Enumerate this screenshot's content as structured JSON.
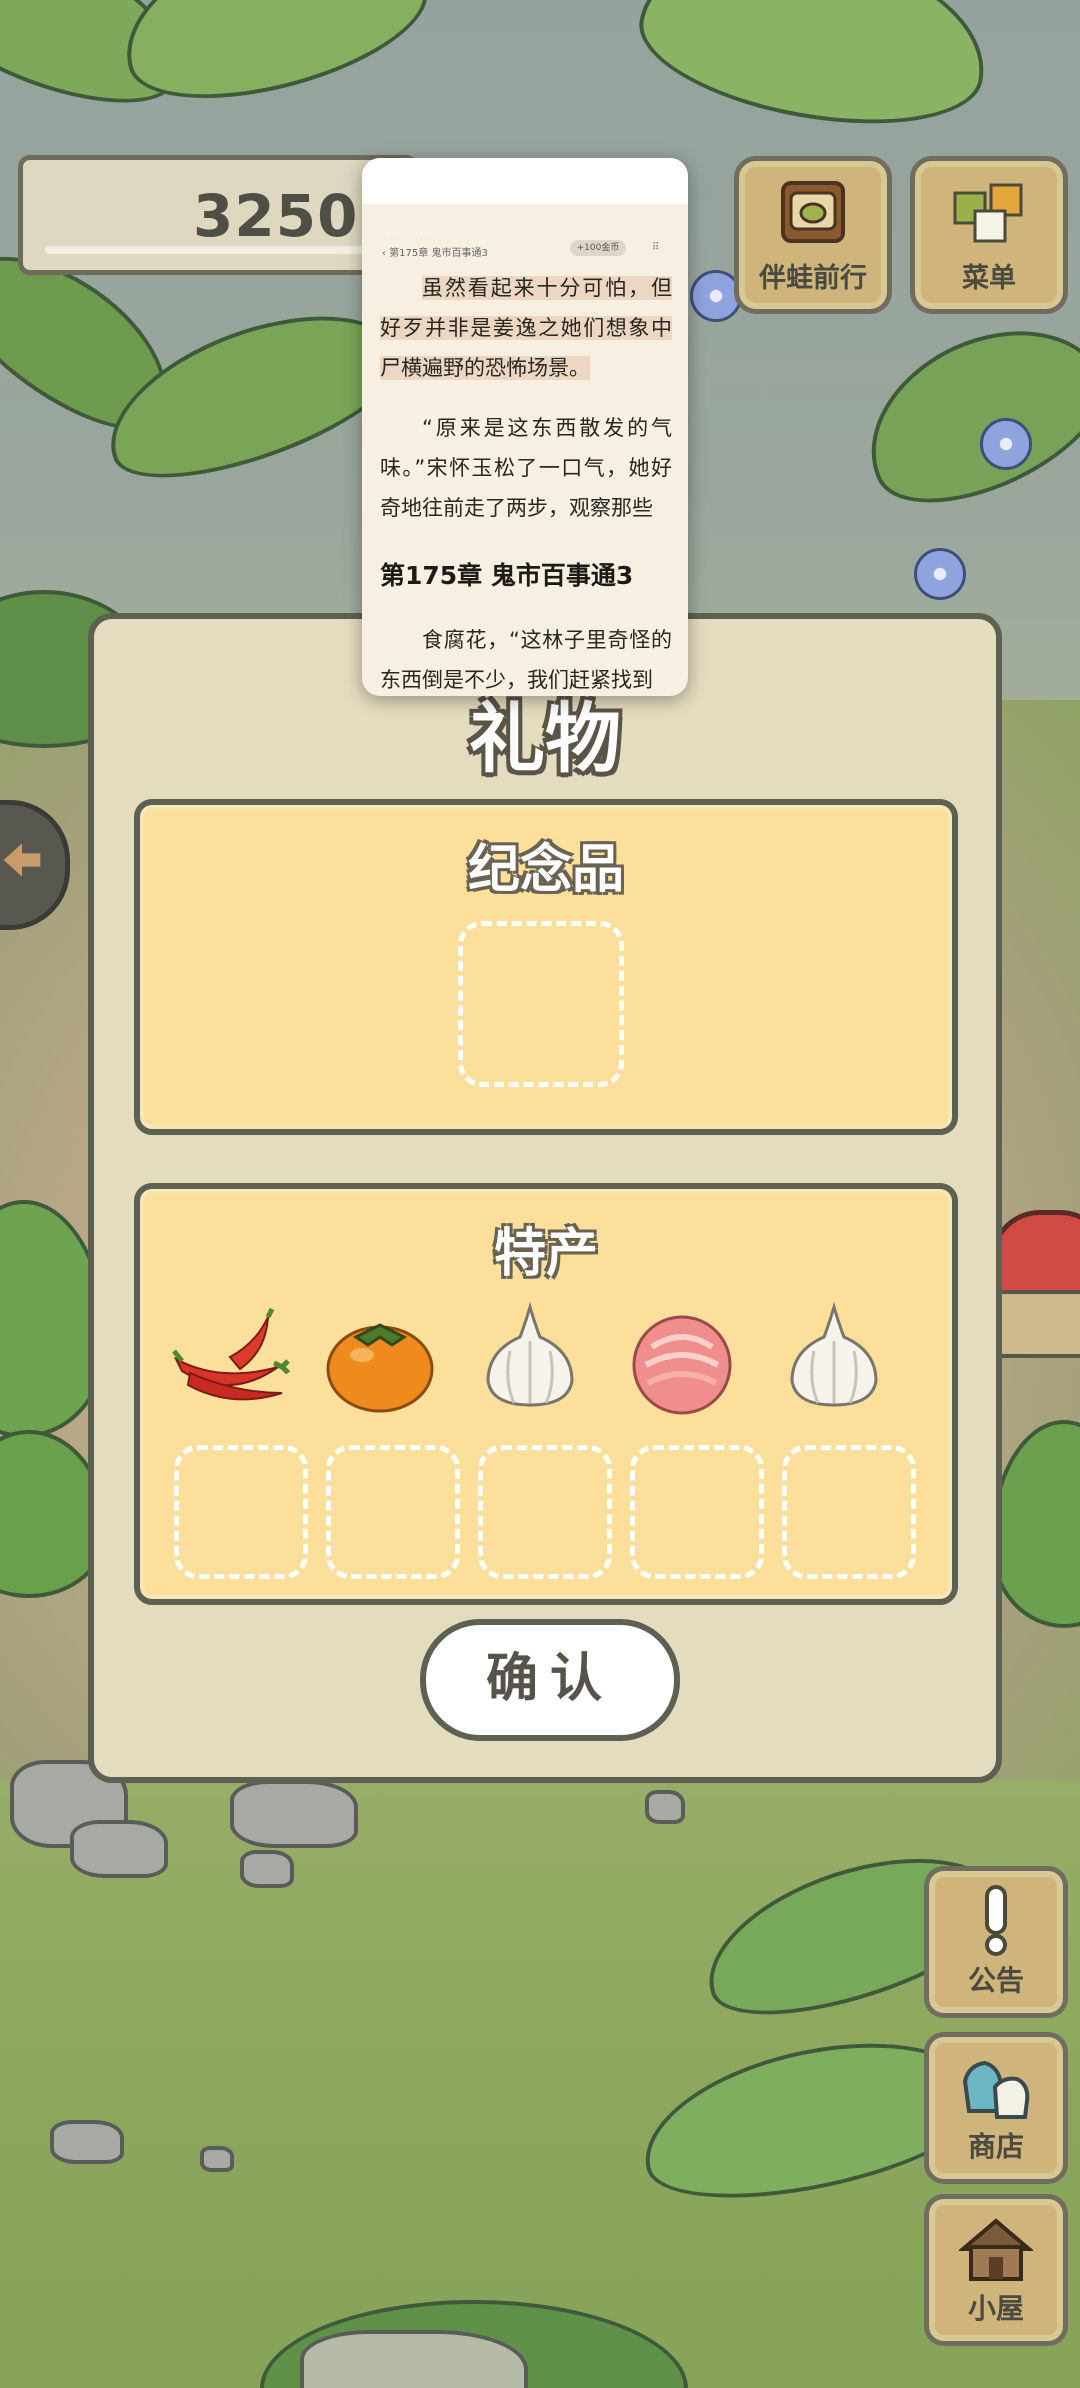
{
  "hud": {
    "clover_count": "3250",
    "buttons": {
      "travel": "伴蛙前行",
      "menu": "菜单",
      "notice": "公告",
      "shop": "商店",
      "house": "小屋"
    }
  },
  "gift_panel": {
    "title": "礼物",
    "souvenir_section": {
      "title": "纪念品"
    },
    "specialty_section": {
      "title": "特产",
      "items": [
        {
          "icon": "chili-pepper-icon"
        },
        {
          "icon": "persimmon-icon"
        },
        {
          "icon": "garlic-icon"
        },
        {
          "icon": "peach-icon"
        },
        {
          "icon": "garlic-icon"
        }
      ]
    },
    "confirm_label": "确认"
  },
  "reader_overlay": {
    "header_chapter": "‹ 第175章 鬼市百事通3",
    "chip": "+100金币",
    "dots": "⠿",
    "paragraph1": "虽然看起来十分可怕，但好歹并非是姜逸之她们想象中尸横遍野的恐怖场景。",
    "paragraph2": "“原来是这东西散发的气味。”宋怀玉松了一口气，她好奇地往前走了两步，观察那些",
    "chapter_title": "第175章 鬼市百事通3",
    "paragraph3": "食腐花，“这林子里奇怪的东西倒是不少，我们赶紧找到"
  }
}
